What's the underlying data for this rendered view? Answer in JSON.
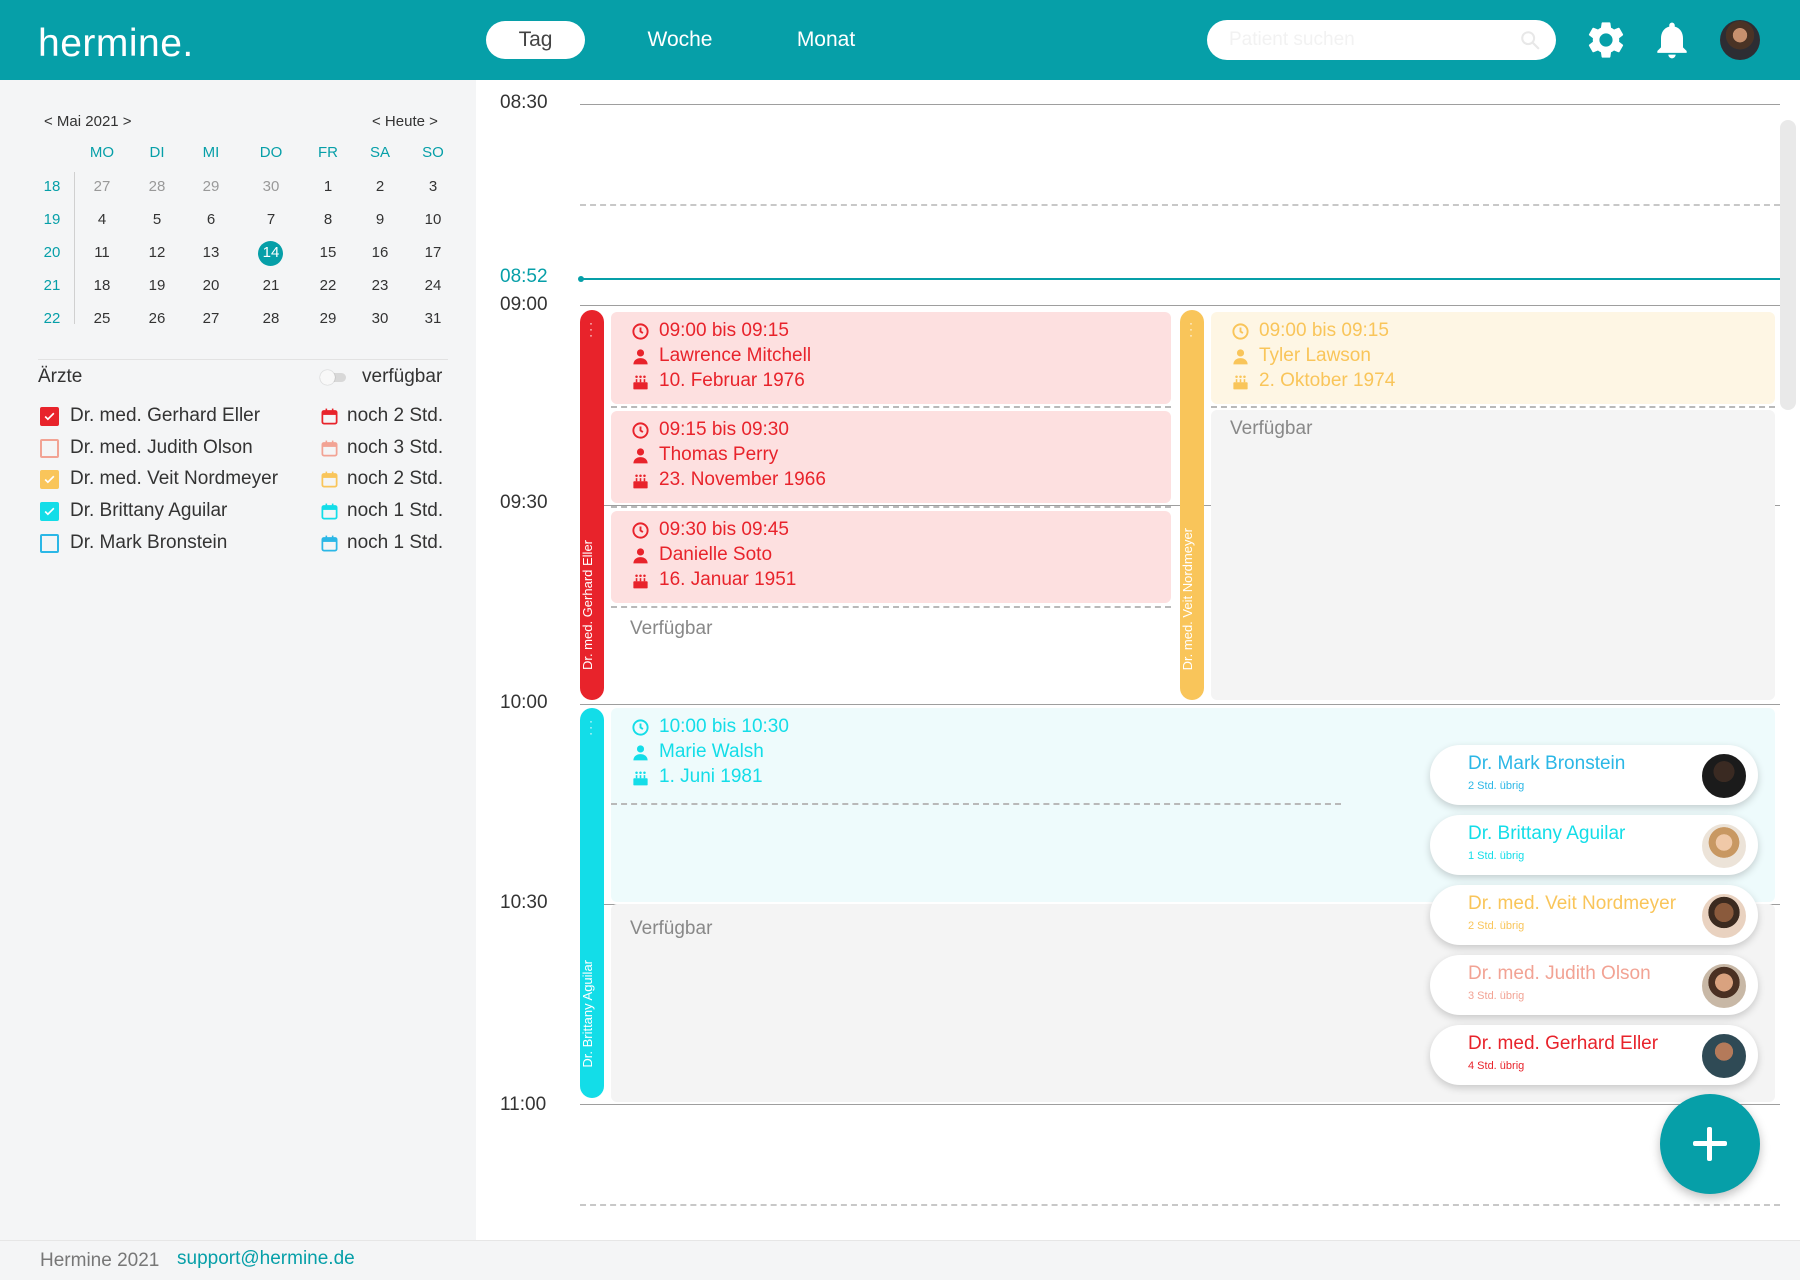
{
  "app": {
    "logo": "hermine."
  },
  "header": {
    "views": [
      "Tag",
      "Woche",
      "Monat"
    ],
    "active_view": "Tag",
    "search_placeholder": "Patient suchen",
    "icons": [
      "search-icon",
      "gear-icon",
      "bell-icon",
      "user-avatar"
    ]
  },
  "mini_calendar": {
    "month_label": "< Mai 2021 >",
    "today_label": "< Heute >",
    "weekdays": [
      "MO",
      "DI",
      "MI",
      "DO",
      "FR",
      "SA",
      "SO"
    ],
    "weeks": [
      {
        "number": "18",
        "days": [
          "27",
          "28",
          "29",
          "30",
          "1",
          "2",
          "3"
        ]
      },
      {
        "number": "19",
        "days": [
          "4",
          "5",
          "6",
          "7",
          "8",
          "9",
          "10"
        ]
      },
      {
        "number": "20",
        "days": [
          "11",
          "12",
          "13",
          "14",
          "15",
          "16",
          "17"
        ]
      },
      {
        "number": "21",
        "days": [
          "18",
          "19",
          "20",
          "21",
          "22",
          "23",
          "24"
        ]
      },
      {
        "number": "22",
        "days": [
          "25",
          "26",
          "27",
          "28",
          "29",
          "30",
          "31"
        ]
      }
    ],
    "selected_day": "14"
  },
  "doctors_panel": {
    "title": "Ärzte",
    "toggle_label": "verfügbar",
    "doctors": [
      {
        "name": "Dr. med. Gerhard Eller",
        "remaining": "noch 2 Std.",
        "color": "#e8232b",
        "checked": true
      },
      {
        "name": "Dr. med. Judith Olson",
        "remaining": "noch 3 Std.",
        "color": "#f2a394",
        "checked": false
      },
      {
        "name": "Dr. med. Veit Nordmeyer",
        "remaining": "noch 2 Std.",
        "color": "#f9c55a",
        "checked": true
      },
      {
        "name": "Dr. Brittany Aguilar",
        "remaining": "noch 1 Std.",
        "color": "#13dde8",
        "checked": true
      },
      {
        "name": "Dr. Mark Bronstein",
        "remaining": "noch 1 Std.",
        "color": "#2bb7e6",
        "checked": false
      }
    ]
  },
  "timeline": {
    "times": [
      "08:30",
      "09:00",
      "09:30",
      "10:00",
      "10:30",
      "11:00"
    ],
    "now": "08:52",
    "columns": [
      {
        "doctor": "Dr. med. Gerhard Eller",
        "color": "#e8232b"
      },
      {
        "doctor": "Dr. med. Veit Nordmeyer",
        "color": "#f9c55a"
      },
      {
        "doctor": "Dr. Brittany Aguilar",
        "color": "#13dde8"
      }
    ],
    "appointments": [
      {
        "time": "09:00 bis 09:15",
        "patient": "Lawrence Mitchell",
        "birthday": "10. Februar 1976",
        "doctor": "Dr. med. Gerhard Eller",
        "color": "#e8232b"
      },
      {
        "time": "09:15 bis 09:30",
        "patient": "Thomas Perry",
        "birthday": "23. November 1966",
        "doctor": "Dr. med. Gerhard Eller",
        "color": "#e8232b"
      },
      {
        "time": "09:30 bis 09:45",
        "patient": "Danielle Soto",
        "birthday": "16. Januar 1951",
        "doctor": "Dr. med. Gerhard Eller",
        "color": "#e8232b"
      },
      {
        "time": "09:00 bis 09:15",
        "patient": "Tyler Lawson",
        "birthday": "2. Oktober 1974",
        "doctor": "Dr. med. Veit Nordmeyer",
        "color": "#f9c55a"
      },
      {
        "time": "10:00 bis 10:30",
        "patient": "Marie Walsh",
        "birthday": "1. Juni 1981",
        "doctor": "Dr. Brittany Aguilar",
        "color": "#13dde8"
      }
    ],
    "available_label": "Verfügbar"
  },
  "doctor_cards": [
    {
      "name": "Dr. Mark Bronstein",
      "remaining": "2 Std. übrig",
      "color": "#2bb7e6"
    },
    {
      "name": "Dr. Brittany Aguilar",
      "remaining": "1 Std. übrig",
      "color": "#13dde8"
    },
    {
      "name": "Dr. med. Veit Nordmeyer",
      "remaining": "2 Std. übrig",
      "color": "#f9c55a"
    },
    {
      "name": "Dr. med. Judith Olson",
      "remaining": "3 Std. übrig",
      "color": "#f2a394"
    },
    {
      "name": "Dr. med. Gerhard Eller",
      "remaining": "4 Std. übrig",
      "color": "#e8232b"
    }
  ],
  "fab": {
    "icon": "plus-icon"
  },
  "footer": {
    "text": "Hermine 2021",
    "link": "support@hermine.de"
  }
}
